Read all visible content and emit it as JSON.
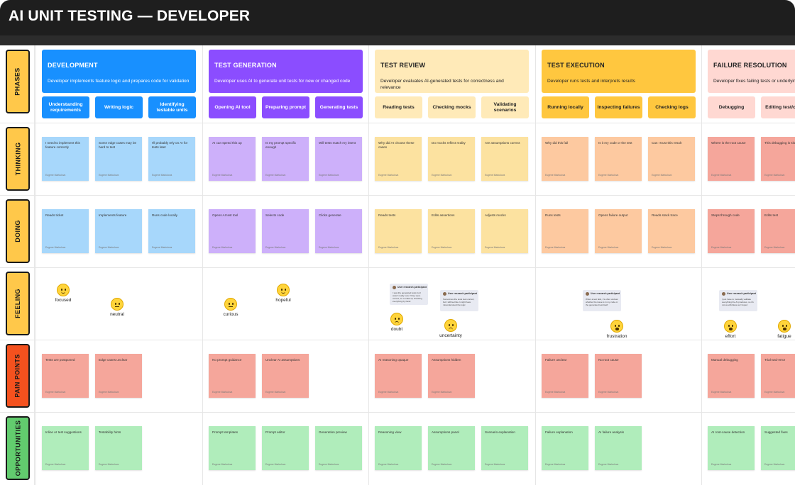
{
  "board_title": "AI UNIT TESTING — DEVELOPER",
  "author": "Eugene Markulova",
  "colors": {
    "titlebar": "#1e1e1e",
    "label_yellow": "#ffc84a",
    "label_red": "#f4511e",
    "label_green": "#62cc6e",
    "development_header": "#1890ff",
    "generation_header": "#8b4dff",
    "review_header": "#ffeab8",
    "execution_header": "#ffc73f",
    "resolution_header": "#ffd8d2",
    "sticky_blue": "#a7d7fb",
    "sticky_purple": "#cdb0fa",
    "sticky_yellow": "#fce2a0",
    "sticky_orange": "#fdc9a0",
    "sticky_salmon": "#f5a69b",
    "sticky_green": "#b0edbb"
  },
  "row_labels": [
    "PHASES",
    "THINKING",
    "DOING",
    "FEELING",
    "PAIN POINTS",
    "OPPORTUNITIES"
  ],
  "phases": [
    {
      "name": "DEVELOPMENT",
      "description": "Developer implements feature logic and prepares code for validation",
      "subtasks": [
        "Understanding requirements",
        "Writing logic",
        "Identifying testable units"
      ],
      "thinking": [
        "I need to implement this feature correctly",
        "Some edge cases may be hard to test",
        "I'll probably rely on AI for tests later"
      ],
      "doing": [
        "Reads ticket",
        "Implements feature",
        "Runs code locally"
      ],
      "feelings": [
        {
          "label": "focused",
          "face": "smile"
        },
        {
          "label": "neutral",
          "face": "flat"
        }
      ],
      "quotes": [],
      "pain_points": [
        "Tests are postponed",
        "Edge cases unclear"
      ],
      "opportunities": [
        "Inline AI test suggestions",
        "Testability hints"
      ]
    },
    {
      "name": "TEST GENERATION",
      "description": "Developer uses AI to generate unit tests for new or changed code",
      "subtasks": [
        "Opening AI tool",
        "Preparing prompt",
        "Generating tests"
      ],
      "thinking": [
        "AI can speed this up",
        "Is my prompt specific enough",
        "Will tests match my intent"
      ],
      "doing": [
        "Opens AI test tool",
        "Selects code",
        "Clicks generate"
      ],
      "feelings": [
        {
          "label": "curious",
          "face": "flat"
        },
        {
          "label": "hopeful",
          "face": "smile"
        }
      ],
      "quotes": [],
      "pain_points": [
        "No prompt guidance",
        "Unclear AI assumptions"
      ],
      "opportunities": [
        "Prompt templates",
        "Prompt editor",
        "Generation preview"
      ]
    },
    {
      "name": "TEST REVIEW",
      "description": "Developer evaluates AI-generated tests for correctness and relevance",
      "subtasks": [
        "Reading tests",
        "Checking mocks",
        "Validating scenarios"
      ],
      "thinking": [
        "Why did AI choose these cases",
        "Do mocks reflect reality",
        "Are assumptions correct"
      ],
      "doing": [
        "Reads tests",
        "Edits assertions",
        "Adjusts mocks"
      ],
      "feelings": [
        {
          "label": "doubt",
          "face": "frown"
        },
        {
          "label": "uncertainty",
          "face": "frown"
        }
      ],
      "quotes": [
        {
          "name": "User research participant",
          "text": "I saw the generated tests but I wasn't really sure if they were correct, so I ended up checking everything by hand"
        },
        {
          "name": "User research participant",
          "text": "Sometimes the tests look correct, but I still feel like I might have misunderstood the logic"
        }
      ],
      "pain_points": [
        "AI reasoning opaque",
        "Assumptions hidden"
      ],
      "opportunities": [
        "Reasoning view",
        "Assumptions panel",
        "Scenario explanation"
      ]
    },
    {
      "name": "TEST EXECUTION",
      "description": "Developer runs tests and interprets results",
      "subtasks": [
        "Running locally",
        "Inspecting failures",
        "Checking logs"
      ],
      "thinking": [
        "Why did this fail",
        "Is it my code or the test",
        "Can I trust this result"
      ],
      "doing": [
        "Runs tests",
        "Opens failure output",
        "Reads stack trace"
      ],
      "feelings": [
        {
          "label": "frustration",
          "face": "open"
        }
      ],
      "quotes": [
        {
          "name": "User research participant",
          "text": "When a test fails, it's often unclear whether the issue is in my code or the generated test itself"
        }
      ],
      "pain_points": [
        "Failure unclear",
        "No root cause"
      ],
      "opportunities": [
        "Failure explanation",
        "AI failure analysis"
      ]
    },
    {
      "name": "FAILURE RESOLUTION",
      "description": "Developer fixes failing tests or underlying code",
      "subtasks": [
        "Debugging",
        "Editing test/code"
      ],
      "thinking": [
        "Where is the root cause",
        "This debugging is slow"
      ],
      "doing": [
        "Steps through code",
        "Edits test"
      ],
      "feelings": [
        {
          "label": "effort",
          "face": "open"
        },
        {
          "label": "fatigue",
          "face": "open"
        }
      ],
      "quotes": [
        {
          "name": "User research participant",
          "text": "I just have to manually validate everything the AI produces, so it's not as effortless as I hoped"
        }
      ],
      "pain_points": [
        "Manual debugging",
        "Trial-and-error"
      ],
      "opportunities": [
        "AI root-cause detection",
        "Suggested fixes"
      ]
    }
  ]
}
